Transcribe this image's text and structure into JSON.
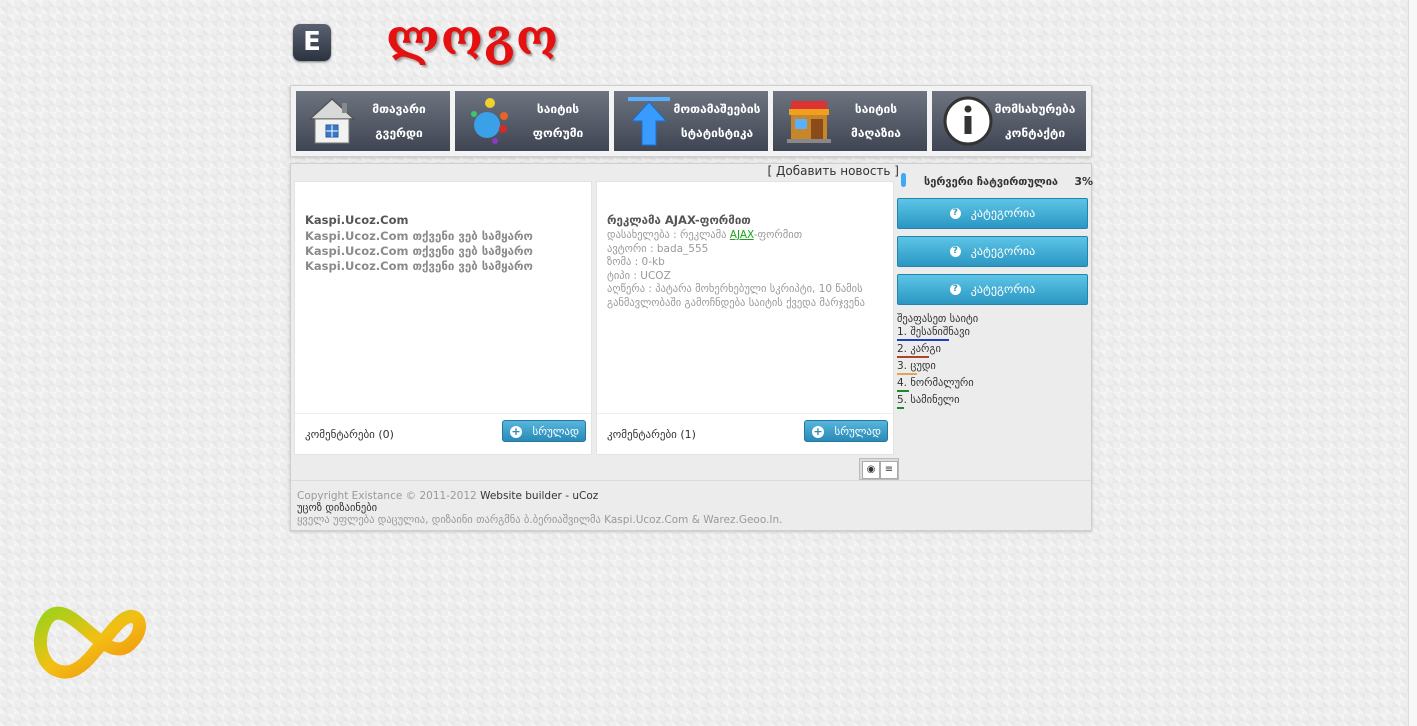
{
  "header": {
    "icon_letter": "E",
    "logo_text": "ლოგო"
  },
  "nav": [
    {
      "line1": "მთავარი",
      "line2": "გვერდი",
      "icon": "home-icon"
    },
    {
      "line1": "საიტის",
      "line2": "ფორუმი",
      "icon": "forum-bubbles-icon"
    },
    {
      "line1": "მოთამაშეების",
      "line2": "სტატისტიკა",
      "icon": "up-arrow-icon"
    },
    {
      "line1": "საიტის",
      "line2": "მაღაზია",
      "icon": "shop-icon"
    },
    {
      "line1": "მომსახურება",
      "line2": "კონტაქტი",
      "icon": "info-icon"
    }
  ],
  "content": {
    "add_news": "[ Добавить новость ]",
    "cards": [
      {
        "title": "Kaspi.Ucoz.Com",
        "lines": [
          "Kaspi.Ucoz.Com თქვენი ვებ სამყარო",
          "Kaspi.Ucoz.Com თქვენი ვებ სამყარო",
          "Kaspi.Ucoz.Com თქვენი ვებ სამყარო"
        ],
        "comments": "კომენტარები (0)",
        "more": "სრულად"
      },
      {
        "title": "რეკლამა AJAX-ფორმით",
        "details": {
          "name_prefix": "დასახელება : რეკლამა ",
          "name_link": "AJAX",
          "name_suffix": "-ფორმით",
          "author": "ავტორი : bada_555",
          "size": "ზომა : 0-kb",
          "type": "ტიპი : UCOZ",
          "desc1": "აღწერა : პატარა მოხერხებული სკრიპტი, 10 წამის",
          "desc2": "განმავლობაში გამოჩნდება საიტის ქვედა მარჯვენა"
        },
        "comments": "კომენტარები (1)",
        "more": "სრულად"
      }
    ]
  },
  "sidebar": {
    "server_text": "სერვერი ჩატვირთულია",
    "server_pct": "3%",
    "categories": [
      "კატეგორია",
      "კატეგორია",
      "კატეგორია"
    ],
    "poll": {
      "title": "შეაფასეთ საიტი",
      "options": [
        {
          "label": "1. შესანიშნავი",
          "color": "#1f3fbf",
          "level": 0.9
        },
        {
          "label": "2. კარგი",
          "color": "#b0412a",
          "level": 0.55
        },
        {
          "label": "3. ცუდი",
          "color": "#e0a35a",
          "level": 0.35
        },
        {
          "label": "4. ნორმალური",
          "color": "#1c8a2a",
          "level": 0.2
        },
        {
          "label": "5. სამინელი",
          "color": "#1c8a2a",
          "level": 0.12
        }
      ]
    }
  },
  "footer": {
    "copyright_prefix": "Copyright Existance © 2011-2012 ",
    "builder": "Website builder - uCoz",
    "designers": "უცოზ დიზაინები",
    "rights": "ყველა უფლება დაცულია, დიზაინი თარგმნა ბ.ბერიაშვილმა Kaspi.Ucoz.Com & Warez.Geoo.In."
  }
}
